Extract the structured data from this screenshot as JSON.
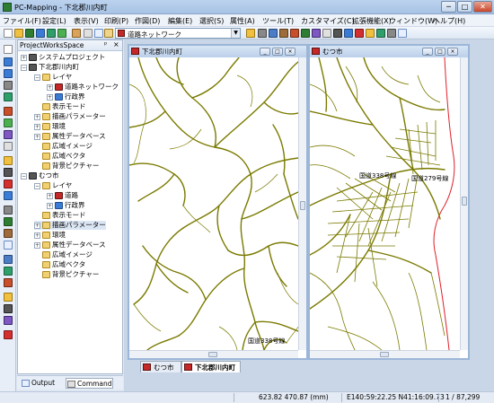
{
  "window": {
    "title": "PC-Mapping - 下北郡川内町",
    "minimize": "─",
    "maximize": "□",
    "close": "✕"
  },
  "menu": [
    "ファイル(F)",
    "設定(L)",
    "表示(V)",
    "印刷(P)",
    "作図(D)",
    "編集(E)",
    "選択(S)",
    "属性(A)",
    "ツール(T)",
    "カスタマイズ(C)",
    "拡張機能(X)",
    "ウィンドウ(W)",
    "ヘルプ(H)"
  ],
  "toolbar": {
    "layer_combo": "道路ネットワーク"
  },
  "workspace": {
    "title": "ProjectWorksSpace",
    "pin": "ᵖ",
    "close": "×",
    "tree": [
      {
        "label": "システムプロジェクト",
        "expander": "+"
      },
      {
        "label": "下北郡川内町",
        "expander": "−"
      },
      {
        "label": "レイヤ",
        "expander": "−"
      },
      {
        "label": "道路ネットワーク",
        "expander": "+"
      },
      {
        "label": "行政界",
        "expander": "+"
      },
      {
        "label": "表示モード",
        "expander": ""
      },
      {
        "label": "描画パラメーター",
        "expander": "+"
      },
      {
        "label": "環境",
        "expander": "+"
      },
      {
        "label": "属性データベース",
        "expander": "+"
      },
      {
        "label": "広域イメージ",
        "expander": ""
      },
      {
        "label": "広域ベクタ",
        "expander": ""
      },
      {
        "label": "背景ピクチャー",
        "expander": ""
      },
      {
        "label": "むつ市",
        "expander": "−"
      },
      {
        "label": "レイヤ",
        "expander": "−"
      },
      {
        "label": "道路",
        "expander": "+"
      },
      {
        "label": "行政界",
        "expander": "+"
      },
      {
        "label": "表示モード",
        "expander": ""
      },
      {
        "label": "描画パラメーター",
        "expander": "+"
      },
      {
        "label": "環境",
        "expander": "+"
      },
      {
        "label": "属性データベース",
        "expander": "+"
      },
      {
        "label": "広域イメージ",
        "expander": ""
      },
      {
        "label": "広域ベクタ",
        "expander": ""
      },
      {
        "label": "背景ピクチャー",
        "expander": ""
      }
    ]
  },
  "bottom_tabs": [
    "Output",
    "Command"
  ],
  "map_windows": [
    {
      "title": "下北郡川内町",
      "road_label": "国道338号線"
    },
    {
      "title": "むつ市",
      "road_labels": [
        "国道338号線",
        "国道279号線"
      ]
    }
  ],
  "doc_tabs": [
    "むつ市",
    "下北郡川内町"
  ],
  "status": {
    "coords": "623.82  470.87  (mm)",
    "latlon": "E140:59:22.25  N41:16:09.73",
    "scale": "1 / 87,299"
  },
  "colors": {
    "road": "#7a7a00",
    "admin_boundary": "#e0202a",
    "title_bar": "#bcd3ee"
  }
}
